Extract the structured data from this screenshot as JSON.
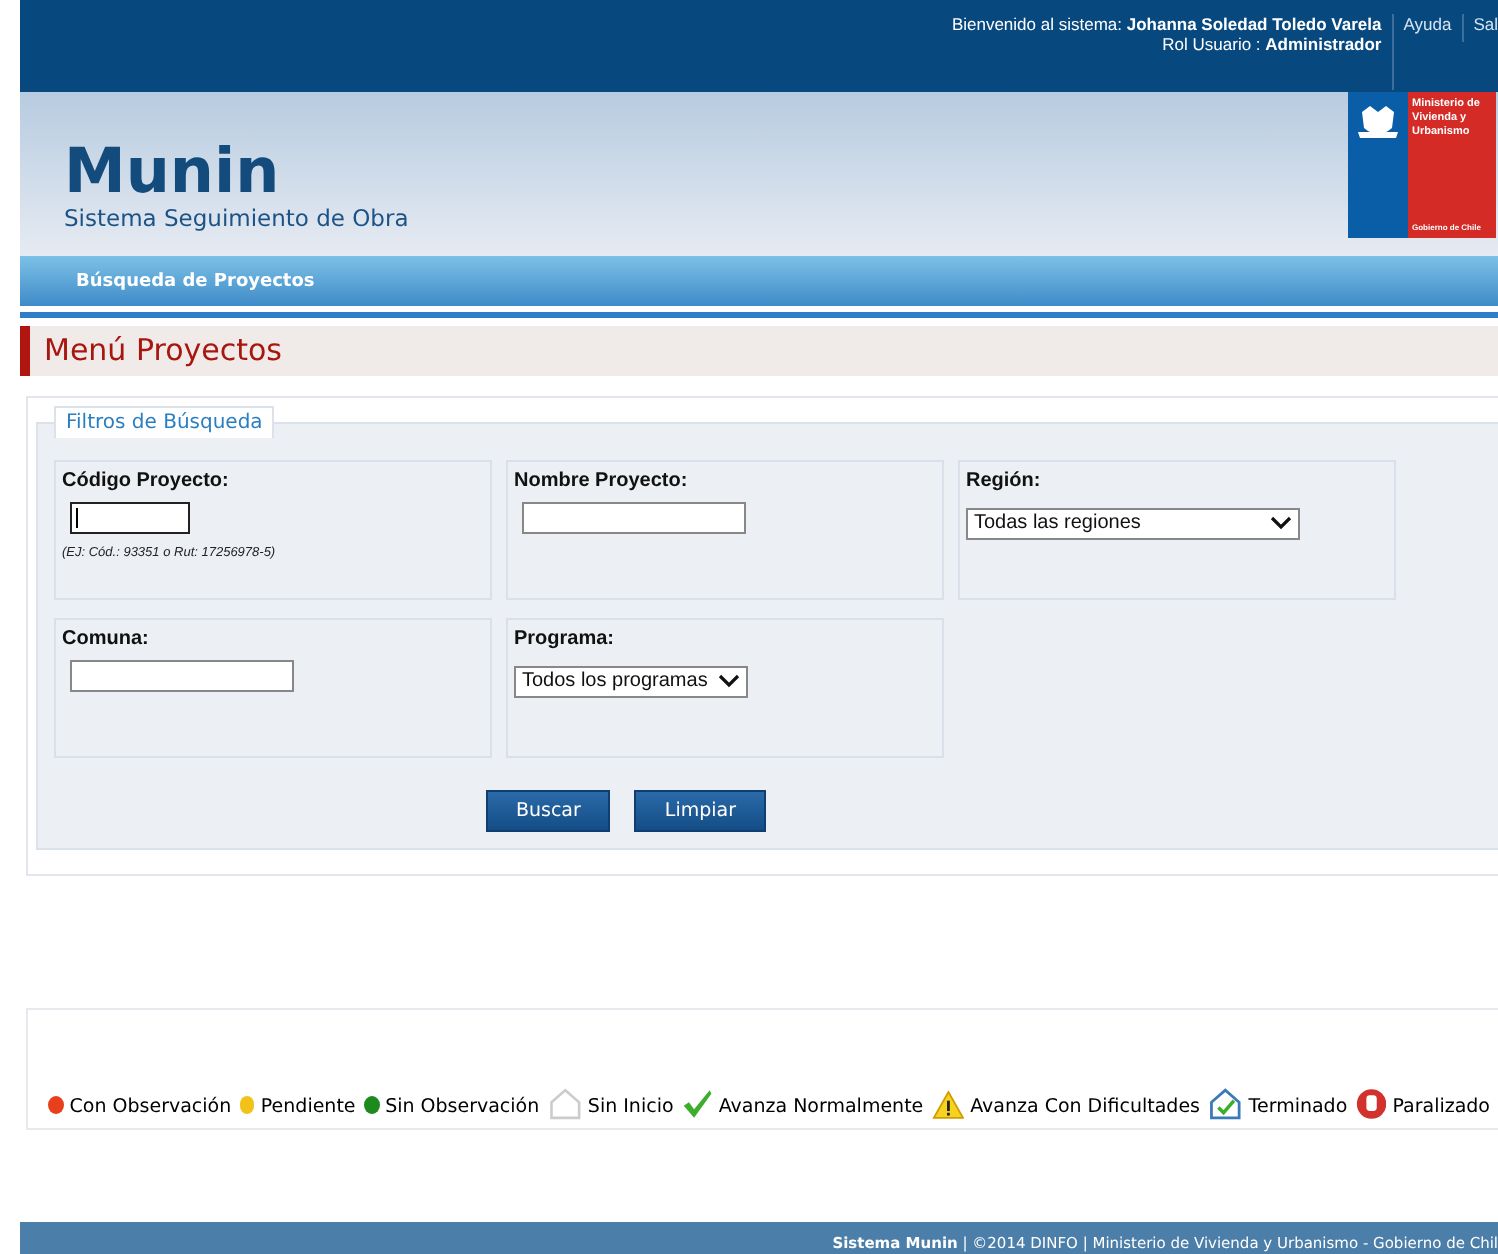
{
  "top_bar": {
    "welcome_label": "Bienvenido al sistema:",
    "user_name": "Johanna Soledad Toledo Varela",
    "role_label": "Rol Usuario :",
    "role": "Administrador",
    "links": [
      "Ayuda",
      "Sal"
    ]
  },
  "header": {
    "app_name": "Munin",
    "subtitle": "Sistema Seguimiento de Obra",
    "logo": {
      "ministry": "Ministerio de Vivienda y Urbanismo",
      "government": "Gobierno de Chile"
    }
  },
  "nav": {
    "items": [
      "Búsqueda de Proyectos"
    ]
  },
  "page_title": "Menú Proyectos",
  "filters": {
    "legend": "Filtros de Búsqueda",
    "fields": [
      {
        "kind": "input",
        "label": "Código Proyecto:",
        "hint": "(EJ: Cód.: 93351 o Rut: 17256978-5)",
        "focused": true
      },
      {
        "kind": "input",
        "label": "Nombre Proyecto:",
        "focused": false
      },
      {
        "kind": "select",
        "label": "Región:",
        "value": "Todas las regiones"
      },
      {
        "kind": "input",
        "label": "Comuna:",
        "focused": false
      },
      {
        "kind": "select",
        "label": "Programa:",
        "value": "Todos los programas"
      }
    ],
    "buttons": [
      "Buscar",
      "Limpiar"
    ]
  },
  "legend_items": [
    {
      "kind": "dot",
      "color": "#e8401c",
      "label": "Con Observación"
    },
    {
      "kind": "dot",
      "color": "#f2c21a",
      "label": "Pendiente"
    },
    {
      "kind": "dot",
      "color": "#1e8a1e",
      "label": "Sin Observación"
    },
    {
      "kind": "house",
      "label": "Sin Inicio"
    },
    {
      "kind": "check",
      "label": "Avanza Normalmente"
    },
    {
      "kind": "warning",
      "label": "Avanza Con Dificultades"
    },
    {
      "kind": "house-check",
      "label": "Terminado"
    },
    {
      "kind": "stop",
      "label": "Paralizado"
    }
  ],
  "footer": {
    "app": "Sistema Munin",
    "text": "| ©2014 DINFO | Ministerio de Vivienda y Urbanismo - Gobierno de Chil"
  }
}
